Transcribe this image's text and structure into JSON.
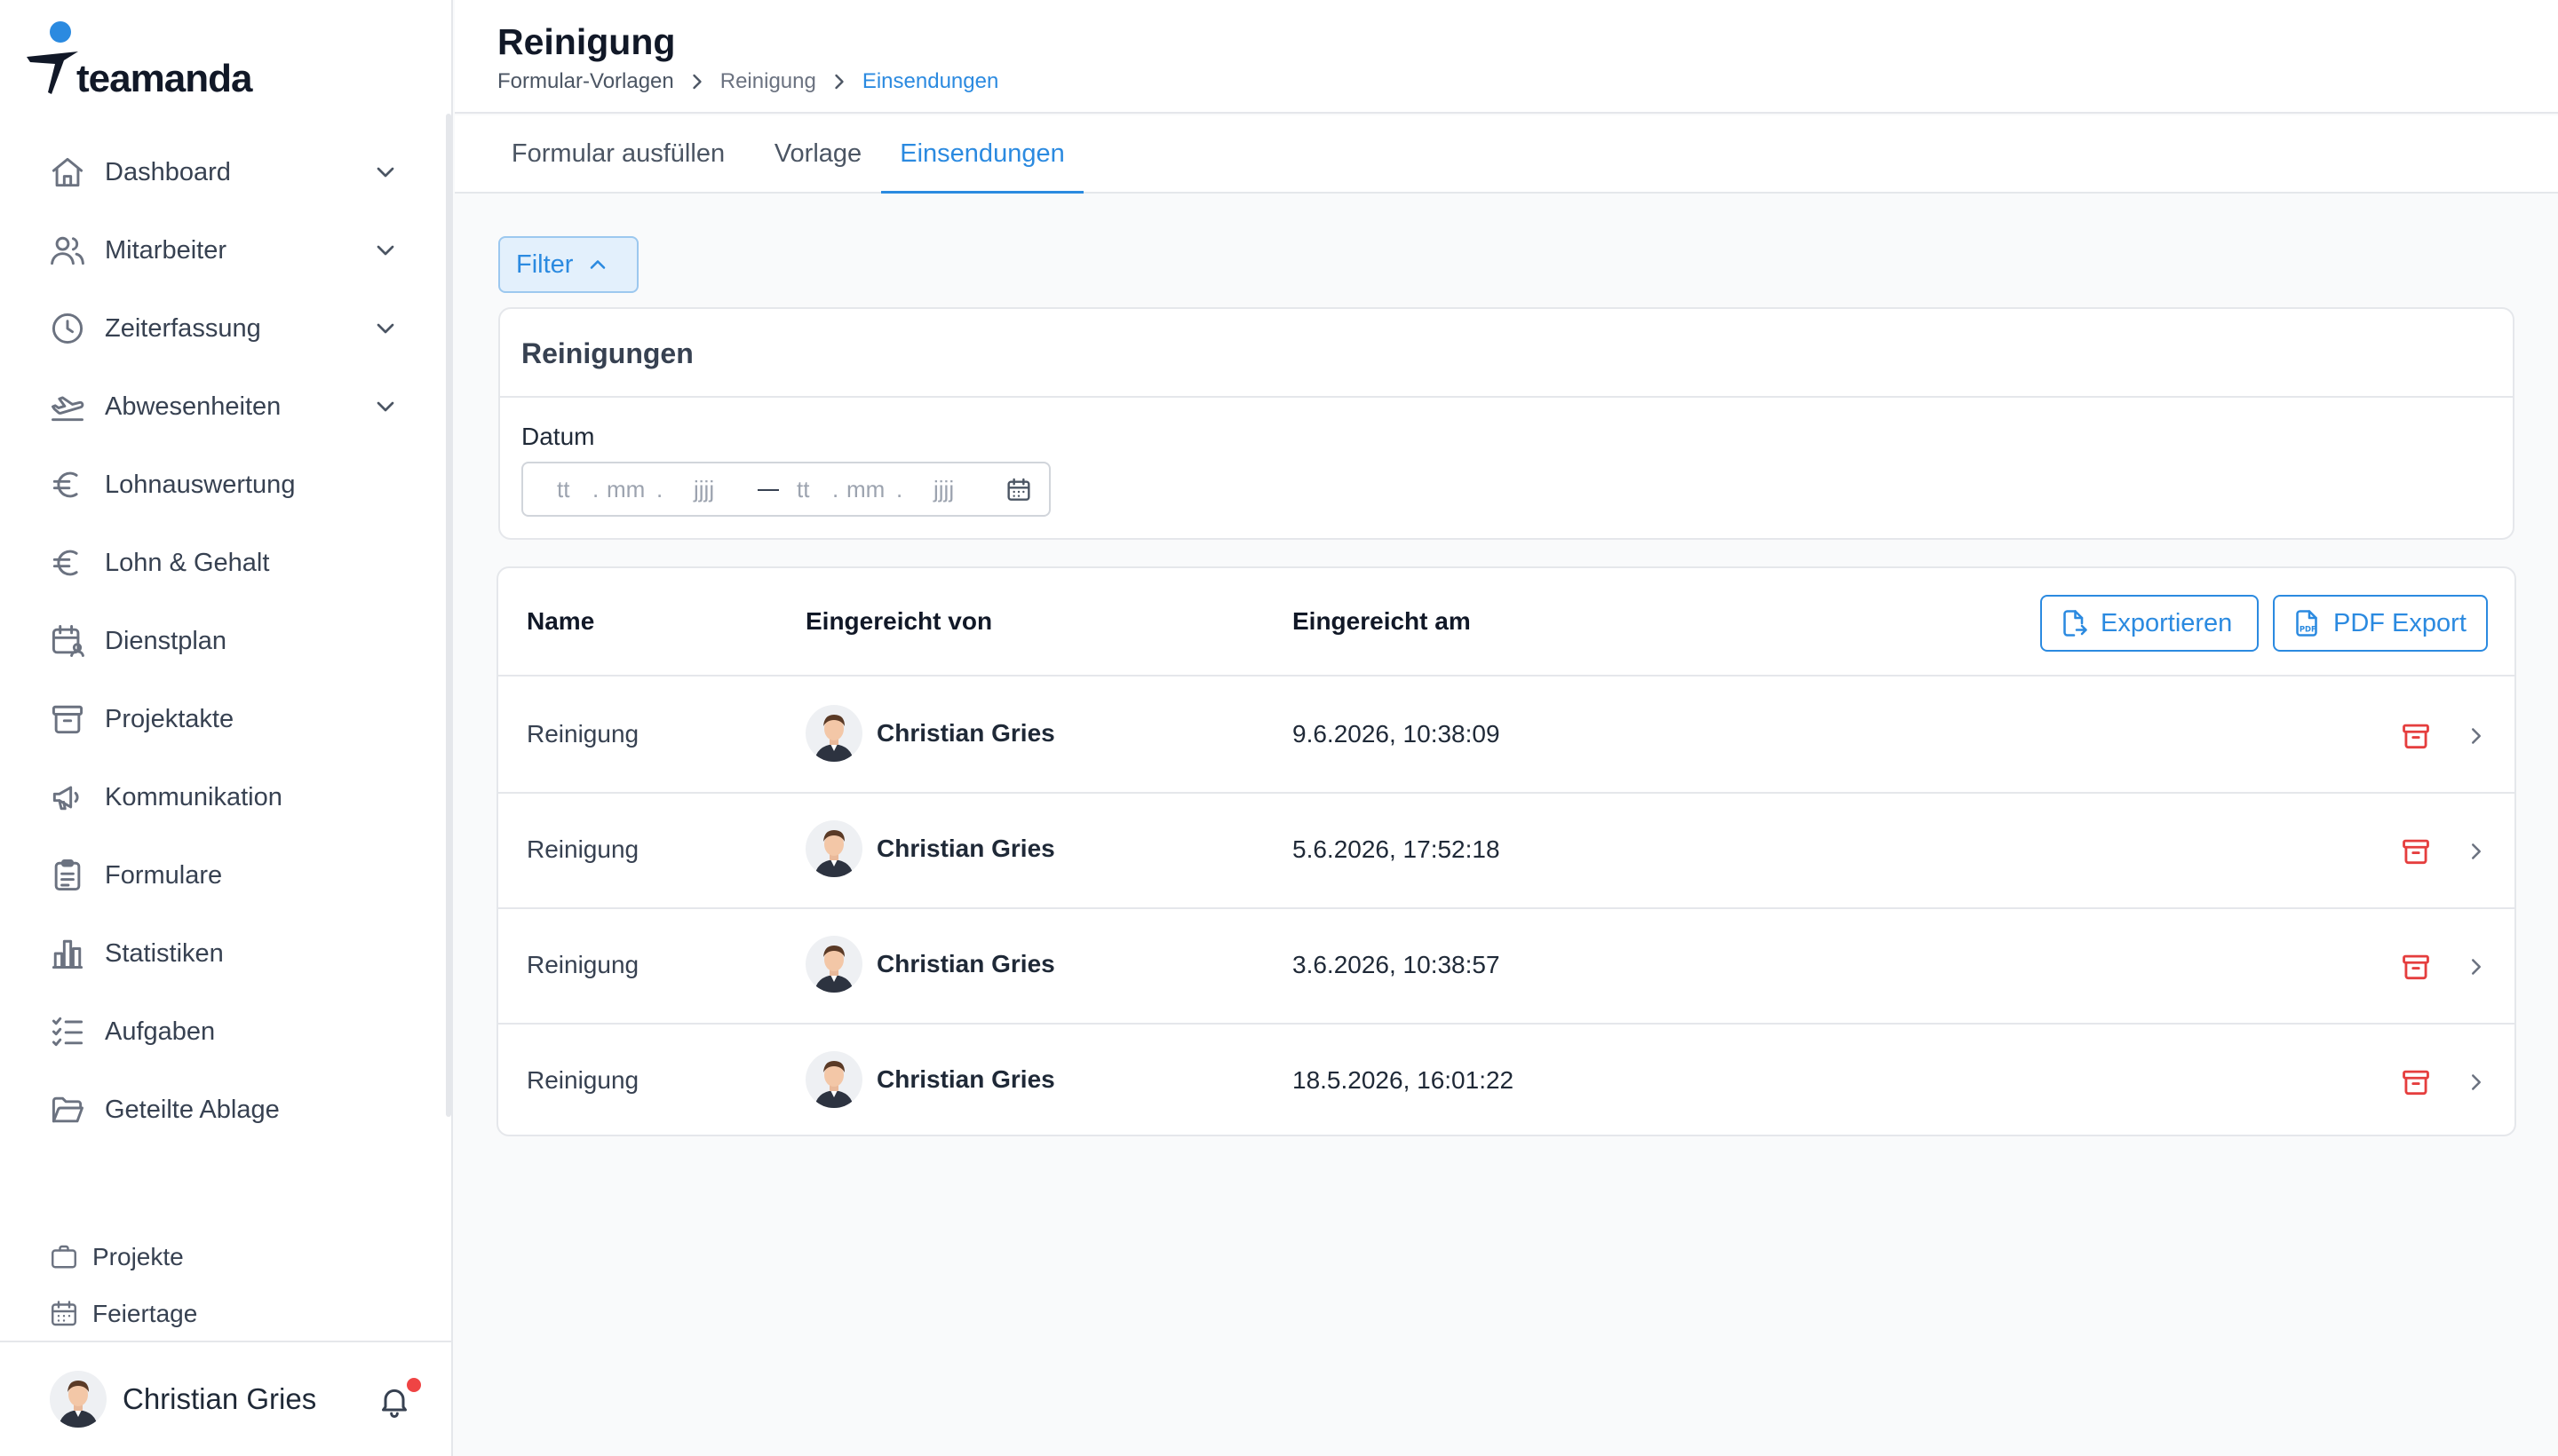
{
  "app": {
    "brand": "teamanda",
    "accent_color": "#2b8ae0",
    "danger_color": "#e53e3e"
  },
  "sidebar": {
    "items": [
      {
        "label": "Dashboard",
        "icon": "home-icon",
        "expandable": true
      },
      {
        "label": "Mitarbeiter",
        "icon": "users-icon",
        "expandable": true
      },
      {
        "label": "Zeiterfassung",
        "icon": "clock-icon",
        "expandable": true
      },
      {
        "label": "Abwesenheiten",
        "icon": "plane-takeoff-icon",
        "expandable": true
      },
      {
        "label": "Lohnauswertung",
        "icon": "euro-icon",
        "expandable": false
      },
      {
        "label": "Lohn & Gehalt",
        "icon": "euro-icon",
        "expandable": false
      },
      {
        "label": "Dienstplan",
        "icon": "calendar-user-icon",
        "expandable": false
      },
      {
        "label": "Projektakte",
        "icon": "archive-box-icon",
        "expandable": false
      },
      {
        "label": "Kommunikation",
        "icon": "megaphone-icon",
        "expandable": false
      },
      {
        "label": "Formulare",
        "icon": "clipboard-icon",
        "expandable": false
      },
      {
        "label": "Statistiken",
        "icon": "bar-chart-icon",
        "expandable": false
      },
      {
        "label": "Aufgaben",
        "icon": "checklist-icon",
        "expandable": false
      },
      {
        "label": "Geteilte Ablage",
        "icon": "folder-open-icon",
        "expandable": false
      }
    ],
    "secondary": [
      {
        "label": "Projekte",
        "icon": "briefcase-icon"
      },
      {
        "label": "Feiertage",
        "icon": "calendar-icon"
      }
    ],
    "user": {
      "name": "Christian Gries",
      "has_notification": true
    }
  },
  "header": {
    "title": "Reinigung",
    "breadcrumb": [
      "Formular-Vorlagen",
      "Reinigung",
      "Einsendungen"
    ]
  },
  "tabs": [
    {
      "label": "Formular ausfüllen",
      "active": false
    },
    {
      "label": "Vorlage",
      "active": false
    },
    {
      "label": "Einsendungen",
      "active": true
    }
  ],
  "filter": {
    "button_label": "Filter",
    "card_title": "Reinigungen",
    "date_label": "Datum",
    "date_from": {
      "day": "tt",
      "month": "mm",
      "year": "jjjj"
    },
    "date_to": {
      "day": "tt",
      "month": "mm",
      "year": "jjjj"
    }
  },
  "table": {
    "columns": [
      "Name",
      "Eingereicht von",
      "Eingereicht am"
    ],
    "export_label": "Exportieren",
    "pdf_export_label": "PDF Export",
    "rows": [
      {
        "name": "Reinigung",
        "submitted_by": "Christian Gries",
        "submitted_at": "9.6.2026, 10:38:09"
      },
      {
        "name": "Reinigung",
        "submitted_by": "Christian Gries",
        "submitted_at": "5.6.2026, 17:52:18"
      },
      {
        "name": "Reinigung",
        "submitted_by": "Christian Gries",
        "submitted_at": "3.6.2026, 10:38:57"
      },
      {
        "name": "Reinigung",
        "submitted_by": "Christian Gries",
        "submitted_at": "18.5.2026, 16:01:22"
      }
    ]
  }
}
